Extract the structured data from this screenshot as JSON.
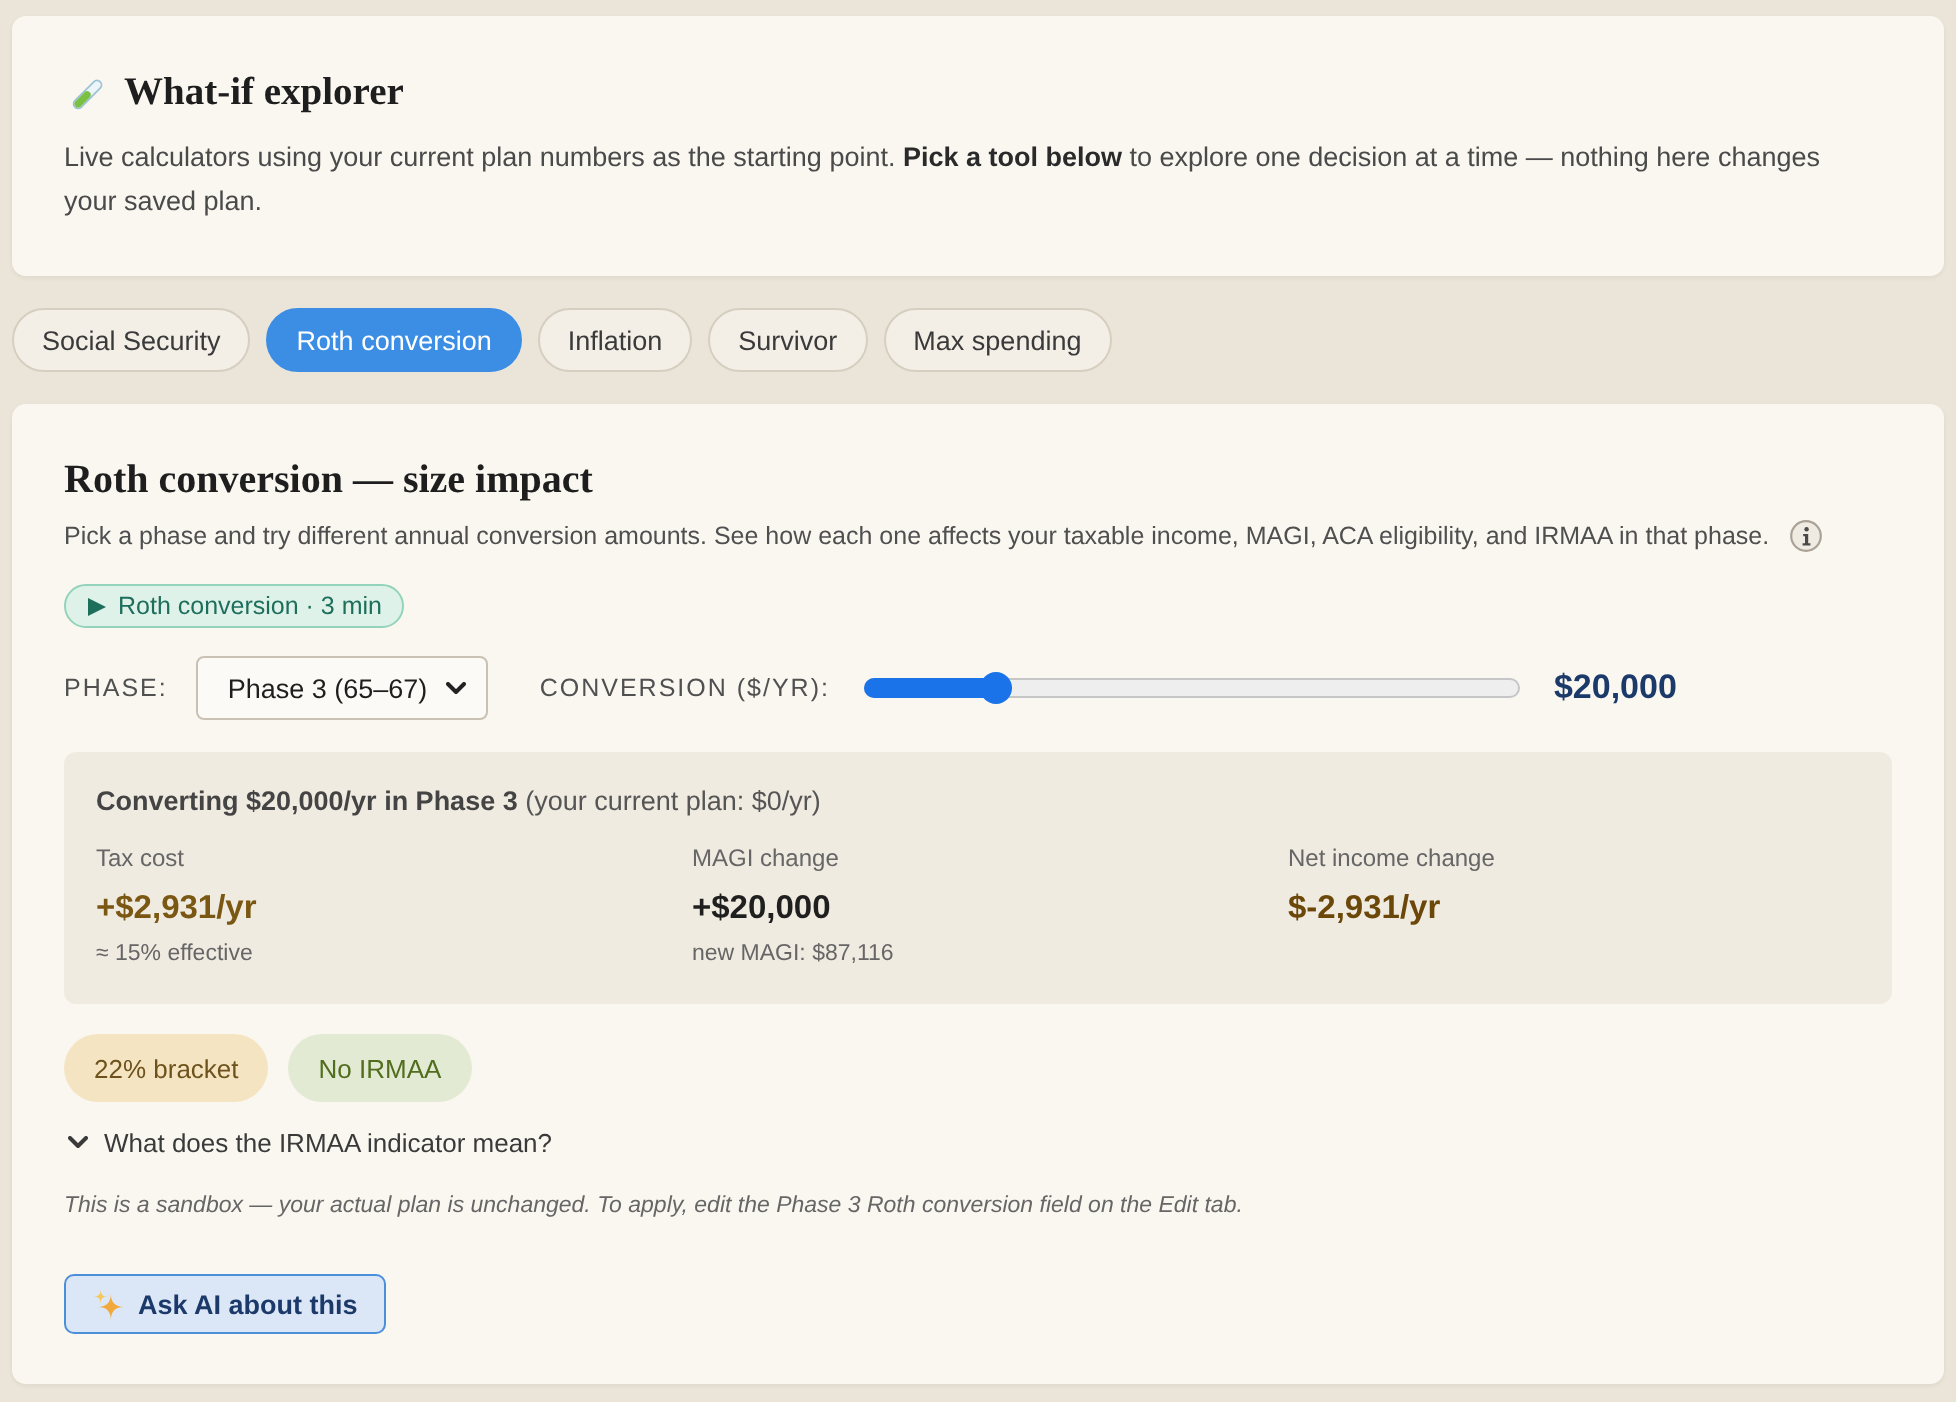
{
  "header": {
    "title": "What-if explorer",
    "description": "Live calculators using your current plan numbers as the starting point. **Pick a tool below** to explore one decision at a time — nothing here changes your saved plan."
  },
  "tabs": [
    {
      "label": "Social Security",
      "selected": false
    },
    {
      "label": "Roth conversion",
      "selected": true
    },
    {
      "label": "Inflation",
      "selected": false
    },
    {
      "label": "Survivor",
      "selected": false
    },
    {
      "label": "Max spending",
      "selected": false
    }
  ],
  "panel": {
    "title": "Roth conversion — size impact",
    "description": "Pick a phase and try different annual conversion amounts. See how each one affects your taxable income, MAGI, ACA eligibility, and IRMAA in that phase.",
    "video_link": "Roth conversion · 3 min",
    "phase": {
      "label": "PHASE:",
      "value": "Phase 3 (65–67)"
    },
    "conversion": {
      "label": "CONVERSION ($/YR):",
      "level": 0.2,
      "reading": "$20,000"
    },
    "result": {
      "summary": "**Converting $20,000/yr in Phase 3** (your current plan: $0/yr)",
      "metrics": [
        {
          "label": "Tax cost",
          "value": "+$2,931/yr",
          "note": "≈ 15% effective",
          "color": "#7a5712"
        },
        {
          "label": "MAGI change",
          "value": "+$20,000",
          "note": "new MAGI: $87,116",
          "color": "#1f1f1f"
        },
        {
          "label": "Net income change",
          "value": "$-2,931/yr",
          "color": "#6b4709"
        }
      ]
    },
    "badges": [
      {
        "label": "22% bracket",
        "color": "#f5e4c2"
      },
      {
        "label": "No IRMAA",
        "color": "#e2ead3"
      }
    ],
    "disclosure": {
      "label": "What does the IRMAA indicator mean?",
      "expanded": false
    },
    "note": "This is a sandbox — your actual plan is unchanged. To apply, edit the Phase 3 Roth conversion field on the Edit tab.",
    "ask_button": "Ask AI about this"
  }
}
